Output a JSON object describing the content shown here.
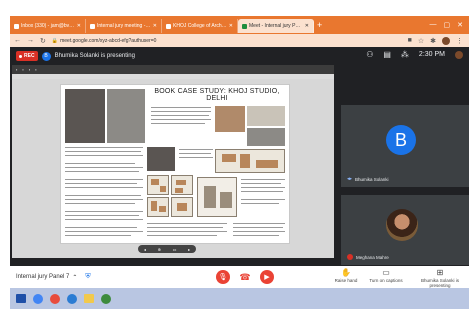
{
  "browser": {
    "tabs": [
      {
        "label": "Inbox (330) - jam@bvcoarch",
        "active": false
      },
      {
        "label": "Internal jury meeting - 2020-21",
        "active": false
      },
      {
        "label": "KHOJ College of Architecture",
        "active": false
      },
      {
        "label": "Meet - Internal jury Panel 7",
        "active": true
      }
    ],
    "new_tab": "+",
    "url": "meet.google.com/xyz-abcd-efg?authuser=0"
  },
  "meet": {
    "rec_label": "REC",
    "presenter_initial": "B",
    "presenting_text": "Bhumika Solanki is presenting",
    "time": "2:30 PM",
    "slide_title": "BOOK CASE STUDY: KHOJ STUDIO, DELHI",
    "participants": [
      {
        "name": "Bhumika Solanki",
        "initial": "B"
      },
      {
        "name": "Meghana Mahre"
      }
    ],
    "meeting_name": "Internal jury Panel 7",
    "controls": {
      "raise_hand": "Raise hand",
      "captions": "Turn on captions",
      "presenting": "Bhumika Solanki is presenting"
    }
  },
  "colors": {
    "tab_strip": "#e9772f",
    "meet_bg": "#202124",
    "accent_blue": "#1a73e8",
    "danger_red": "#ea4335"
  },
  "icons": [
    "mic-off-icon",
    "more-options-icon",
    "end-call-icon",
    "raise-hand-icon",
    "captions-icon",
    "present-icon",
    "chat-icon",
    "people-icon"
  ]
}
